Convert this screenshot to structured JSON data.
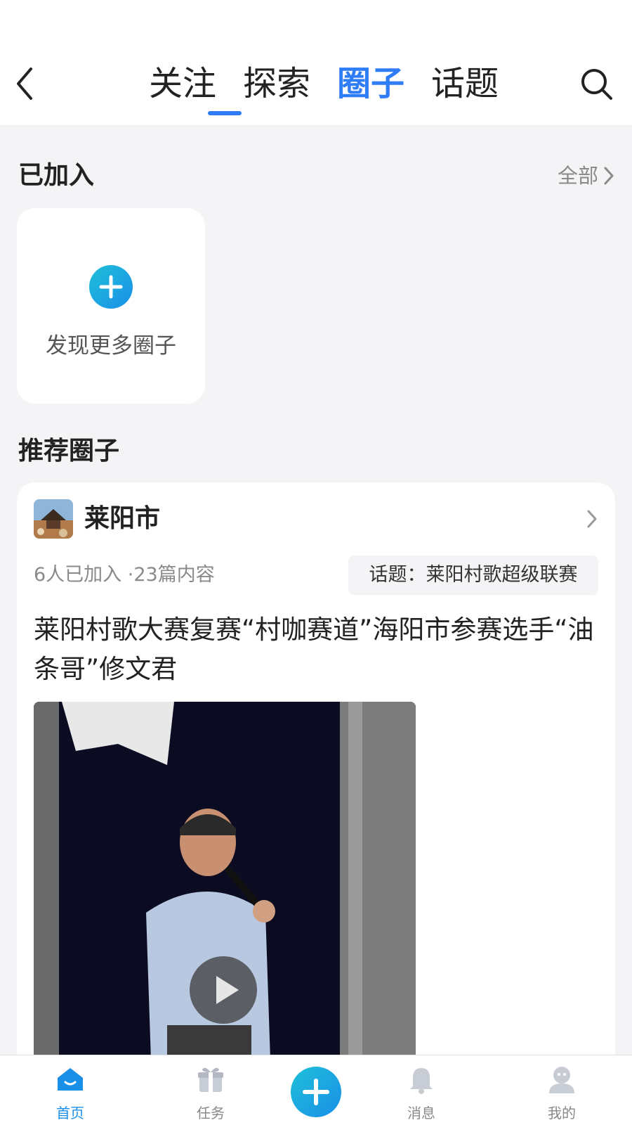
{
  "top_nav": {
    "tabs": [
      {
        "label": "关注"
      },
      {
        "label": "探索"
      },
      {
        "label": "圈子"
      },
      {
        "label": "话题"
      }
    ],
    "active_tab": "圈子",
    "accent_color": "#2e7cf6"
  },
  "joined": {
    "title": "已加入",
    "all_label": "全部",
    "discover_label": "发现更多圈子"
  },
  "recommended": {
    "title": "推荐圈子",
    "circle": {
      "name": "莱阳市",
      "meta": "6人已加入 ·23篇内容",
      "topic": "话题：莱阳村歌超级联赛",
      "post_title": "莱阳村歌大赛复赛“村咖赛道”海阳市参赛选手“油条哥”修文君"
    }
  },
  "bottom_bar": {
    "items": [
      {
        "label": "首页",
        "icon": "home-icon"
      },
      {
        "label": "任务",
        "icon": "gift-icon"
      },
      {
        "label": "消息",
        "icon": "bell-icon"
      },
      {
        "label": "我的",
        "icon": "user-icon"
      }
    ],
    "active": "首页",
    "accent_color": "#1a8fe8"
  }
}
